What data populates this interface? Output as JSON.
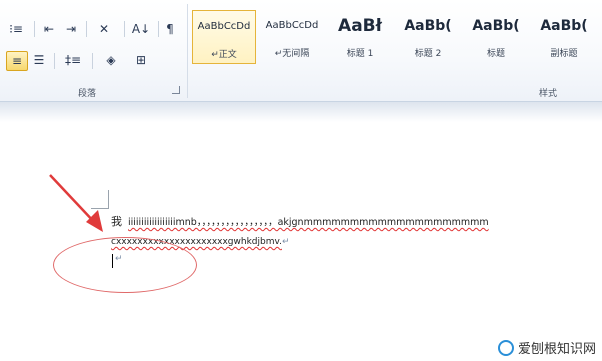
{
  "ribbon": {
    "paragraph_group_label": "段落",
    "styles_group_label": "样式",
    "tools_row1": [
      {
        "name": "multilevel-list-icon",
        "glyph": "⁝≡"
      },
      {
        "name": "decrease-indent-icon",
        "glyph": "⇤"
      },
      {
        "name": "increase-indent-icon",
        "glyph": "⇥"
      },
      {
        "name": "chinese-layout-icon",
        "glyph": "✕"
      },
      {
        "name": "sort-icon",
        "glyph": "A↓"
      },
      {
        "name": "show-formatting-icon",
        "glyph": "¶"
      }
    ],
    "tools_row2": [
      {
        "name": "justify-icon",
        "glyph": "≡"
      },
      {
        "name": "distributed-icon",
        "glyph": "☰"
      },
      {
        "name": "line-spacing-icon",
        "glyph": "‡≡"
      },
      {
        "name": "shading-icon",
        "glyph": "◈"
      },
      {
        "name": "borders-icon",
        "glyph": "⊞"
      }
    ],
    "styles": [
      {
        "sample": "AaBbCcDd",
        "name": "↵正文",
        "selected": true
      },
      {
        "sample": "AaBbCcDd",
        "name": "↵无间隔",
        "selected": false
      },
      {
        "sample": "AaBł",
        "name": "标题 1",
        "selected": false
      },
      {
        "sample": "AaBb(",
        "name": "标题 2",
        "selected": false
      },
      {
        "sample": "AaBb(",
        "name": "标题",
        "selected": false
      },
      {
        "sample": "AaBb(",
        "name": "副标题",
        "selected": false
      }
    ]
  },
  "document": {
    "line1_char": "我",
    "line1_text": "iiiiiiiiiiiiiiiiiimnb，，，，，，，，，，，，，，，，akjgnmmmmmmmmmmmmmmmmmmmm",
    "line2_text": "cxxxxxxxxxxxxxxxxxxxxxgwhkdjbmv.",
    "paragraph_mark": "↵"
  },
  "watermark": {
    "text": "爱刨根知识网"
  },
  "colors": {
    "annotation_red": "#e06a6a",
    "arrow_red": "#e03b3b",
    "selected_style_border": "#e5b43a"
  }
}
